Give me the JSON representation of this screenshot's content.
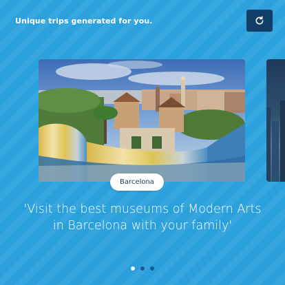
{
  "header": {
    "title": "Unique trips generated for you."
  },
  "refresh": {
    "icon": "refresh-icon"
  },
  "cards": [
    {
      "city": "Barcelona",
      "image": "park-guell-barcelona"
    },
    {
      "image": "city-skyline-night"
    }
  ],
  "quote": {
    "text": "'Visit the best museums of Modern Arts in Barcelona with your family'"
  },
  "pager": {
    "count": 3,
    "active": 1
  },
  "colors": {
    "background": "#2a9fdc",
    "button": "#123f68",
    "badge_text": "#1c3a5e",
    "dot_inactive": "#1b5a8a",
    "dot_active": "#ffffff"
  }
}
